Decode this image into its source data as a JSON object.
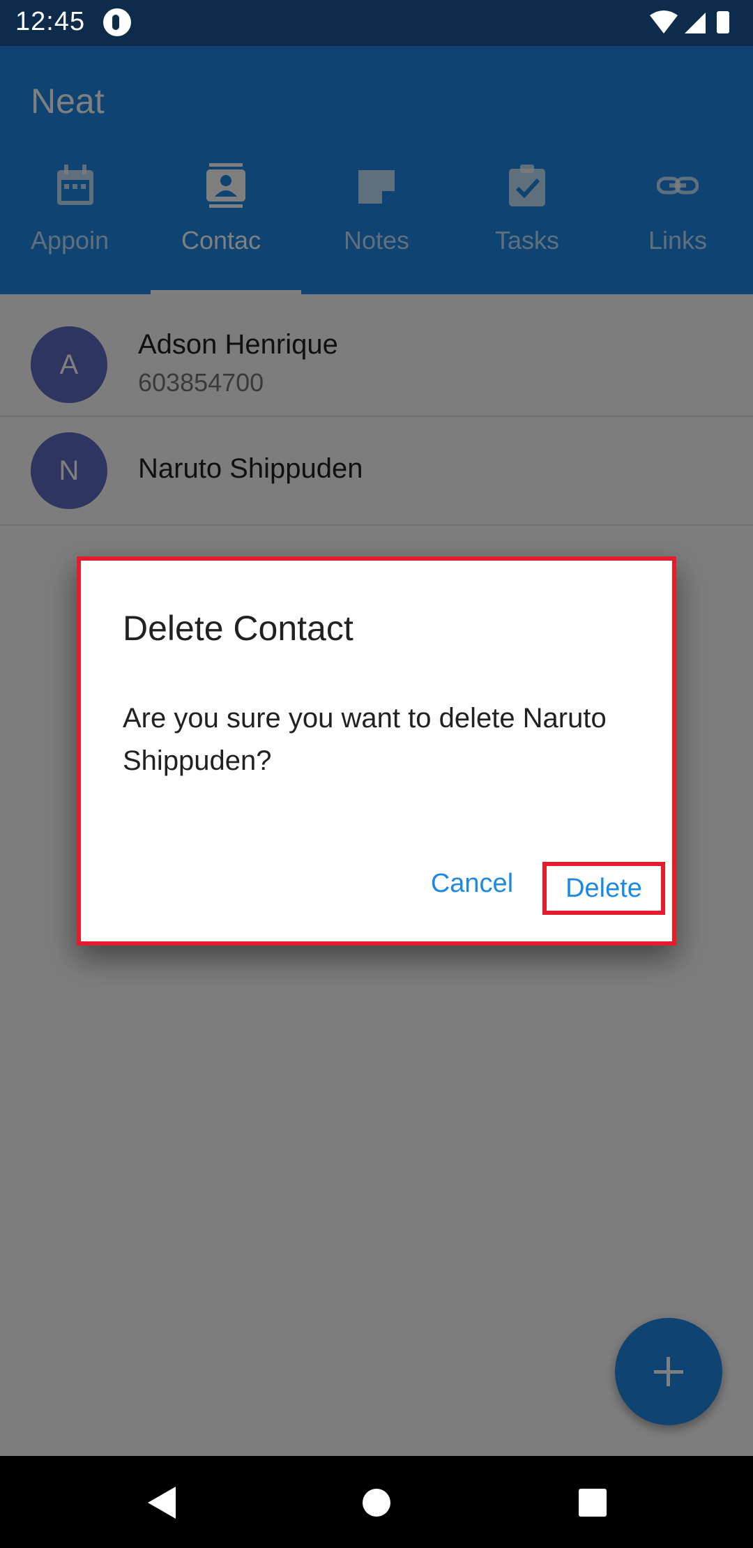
{
  "status_bar": {
    "time": "12:45"
  },
  "app": {
    "title": "Neat",
    "accent_color": "#1e88e5"
  },
  "tabs": [
    {
      "label": "Appoin",
      "icon": "calendar-icon",
      "active": false
    },
    {
      "label": "Contac",
      "icon": "contact-icon",
      "active": true
    },
    {
      "label": "Notes",
      "icon": "note-icon",
      "active": false
    },
    {
      "label": "Tasks",
      "icon": "clipboard-check-icon",
      "active": false
    },
    {
      "label": "Links",
      "icon": "link-icon",
      "active": false
    }
  ],
  "contacts": [
    {
      "initial": "A",
      "name": "Adson Henrique",
      "phone": "603854700"
    },
    {
      "initial": "N",
      "name": "Naruto Shippuden"
    }
  ],
  "dialog": {
    "title": "Delete Contact",
    "message": "Are you sure you want to delete Naruto Shippuden?",
    "cancel_label": "Cancel",
    "delete_label": "Delete",
    "highlight_color": "#e51c2c"
  },
  "fab": {
    "icon": "plus-icon"
  },
  "nav": {
    "back": "back-icon",
    "home": "home-icon",
    "recents": "recents-icon"
  }
}
